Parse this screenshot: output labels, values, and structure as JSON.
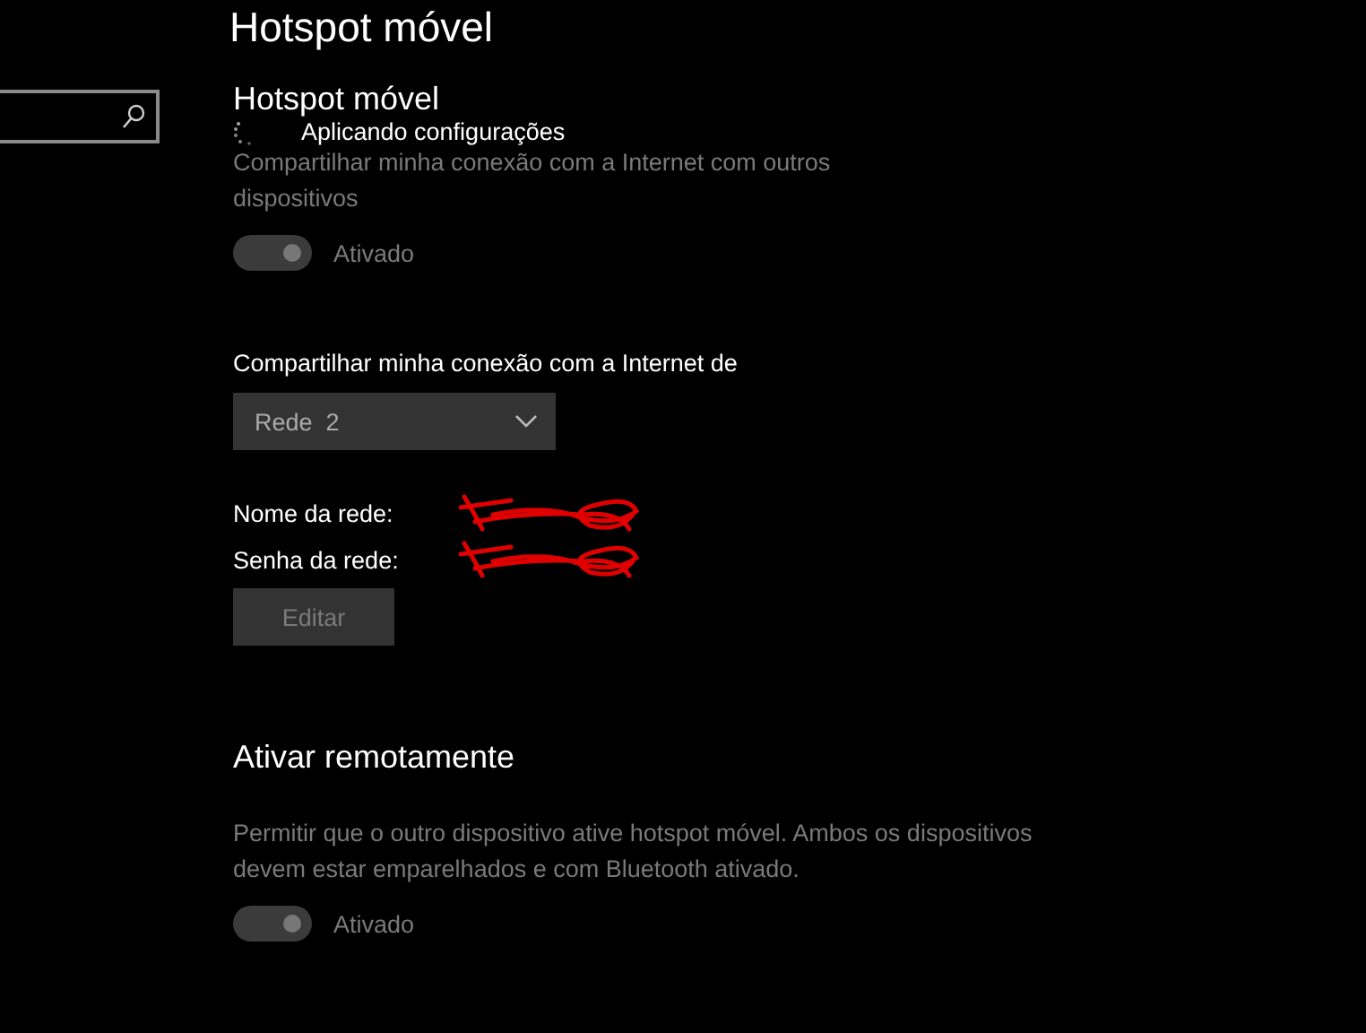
{
  "page_title": "Hotspot móvel",
  "hotspot": {
    "heading": "Hotspot móvel",
    "status": "Aplicando configurações",
    "description": "Compartilhar minha conexão com a Internet com outros dispositivos",
    "toggle": {
      "label": "Ativado",
      "on": true,
      "disabled": true
    }
  },
  "share_from": {
    "label": "Compartilhar minha conexão com a Internet de",
    "value": "Rede  2"
  },
  "network": {
    "fields": [
      {
        "label": "Nome da rede:"
      },
      {
        "label": "Senha da rede:"
      }
    ],
    "edit_button": "Editar"
  },
  "remote": {
    "heading": "Ativar remotamente",
    "description": "Permitir que o outro dispositivo ative hotspot móvel. Ambos os dispositivos devem estar emparelhados e com Bluetooth ativado.",
    "toggle": {
      "label": "Ativado",
      "on": true,
      "disabled": true
    }
  }
}
